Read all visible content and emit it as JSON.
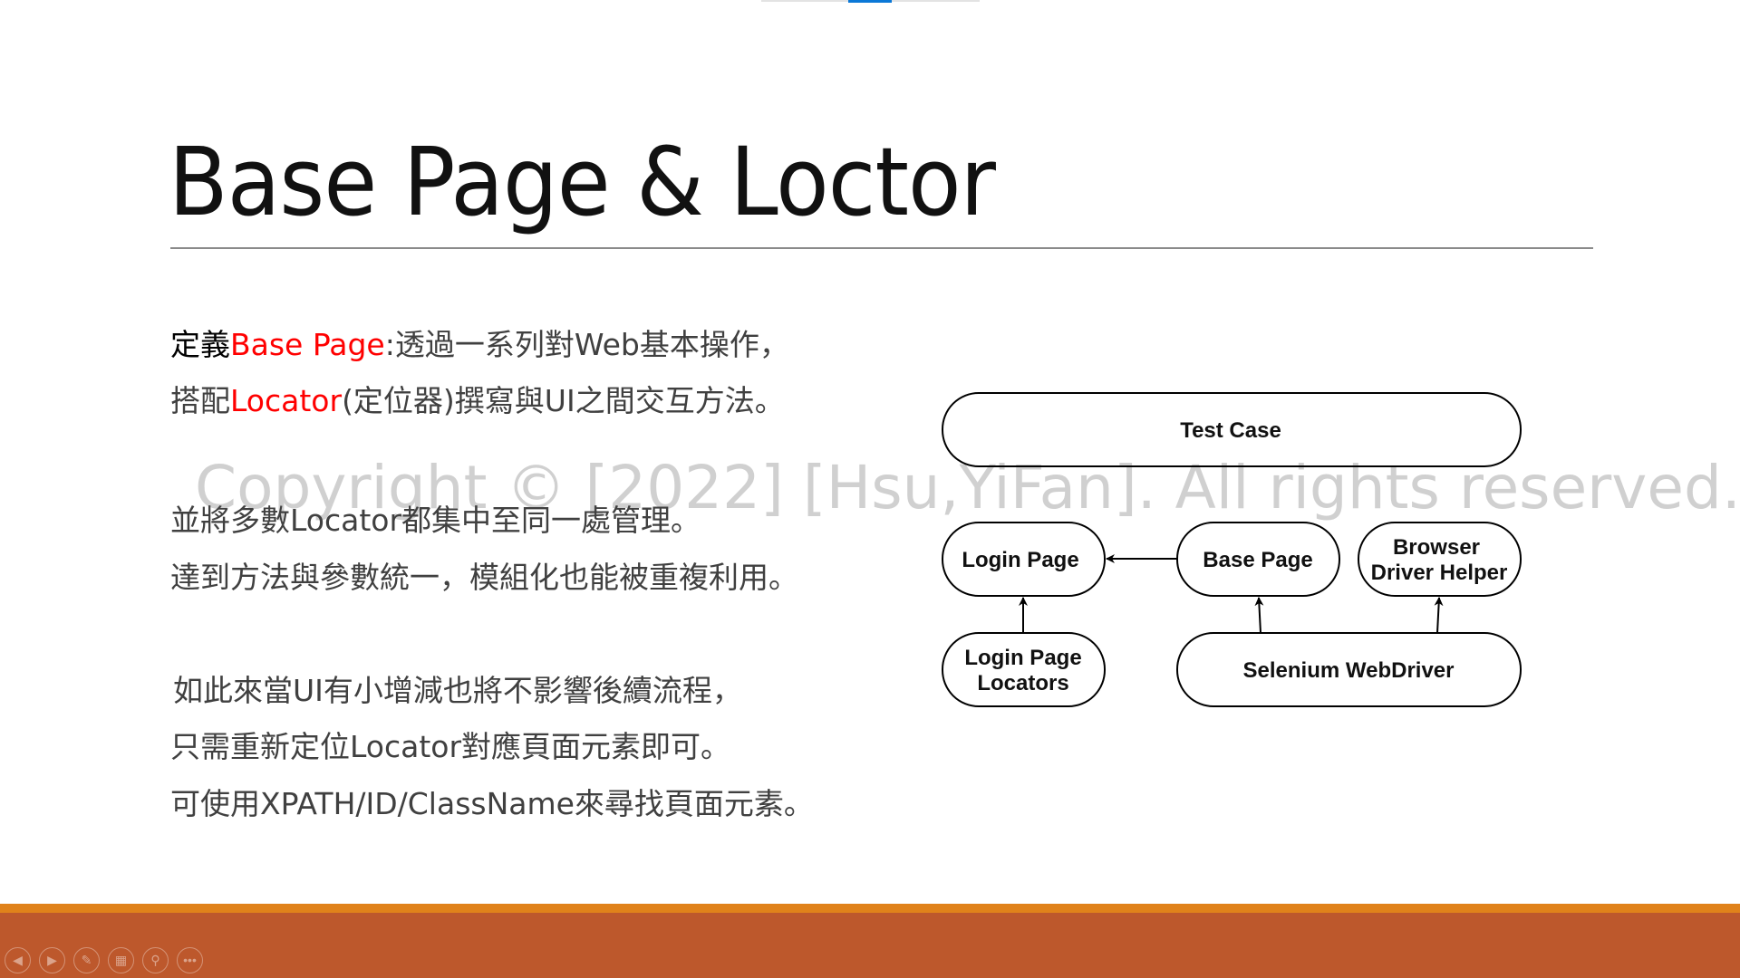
{
  "slide": {
    "title": "Base Page & Loctor",
    "paragraphs": [
      {
        "p1": "定義",
        "p2": "Base Page",
        "p3": ":透過一系列對Web基本操作，"
      },
      {
        "p1": "搭配",
        "p2": "Locator",
        "p3": "(定位器)撰寫與UI之間交互方法。"
      },
      "並將多數Locator都集中至同一處管理。",
      "達到方法與參數統一，模組化也能被重複利用。",
      "如此來當UI有小增減也將不影響後續流程，",
      "只需重新定位Locator對應頁面元素即可。",
      "可使用XPATH/ID/ClassName來尋找頁面元素。"
    ],
    "watermark": "Copyright © [2022] [Hsu,YiFan]. All rights reserved."
  },
  "diagram": {
    "nodes": {
      "test_case": "Test Case",
      "login_page": "Login Page",
      "base_page": "Base Page",
      "browser_helper_1": "Browser",
      "browser_helper_2": "Driver Helper",
      "login_locators_1": "Login Page",
      "login_locators_2": "Locators",
      "selenium": "Selenium WebDriver"
    }
  },
  "controls": [
    "previous-slide",
    "next-slide",
    "pen",
    "see-all-slides",
    "zoom",
    "more-options"
  ],
  "colors": {
    "accent_red": "#ff0000",
    "footer_orange": "#e0821a",
    "footer_rust": "#bd582c",
    "progress_blue": "#0a78d7"
  }
}
